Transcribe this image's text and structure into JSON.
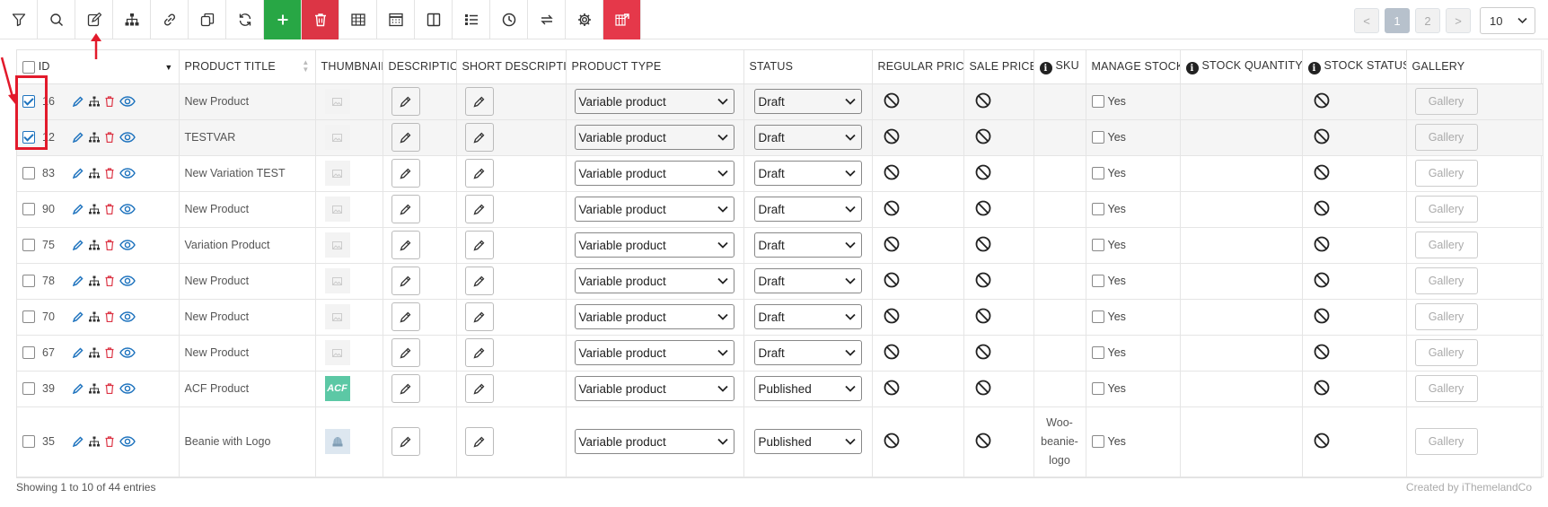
{
  "toolbar": {
    "icons": [
      "filter-icon",
      "search-icon",
      "bulk-edit-icon",
      "sitemap-icon",
      "link-icon",
      "duplicate-icon",
      "refresh-icon",
      "add-icon",
      "trash-icon",
      "table-icon",
      "calendar-grid-icon",
      "columns-icon",
      "list-icon",
      "clock-icon",
      "swap-icon",
      "gear-icon",
      "export-icon"
    ]
  },
  "pagination": {
    "prev": "<",
    "pages": [
      "1",
      "2"
    ],
    "current": "1",
    "next": ">",
    "per_page": "10"
  },
  "table": {
    "columns": {
      "id": "ID",
      "title": "PRODUCT TITLE",
      "thumbnail": "THUMBNAIL",
      "description": "DESCRIPTION",
      "short_description": "SHORT DESCRIPTION",
      "product_type": "PRODUCT TYPE",
      "status": "STATUS",
      "regular_price": "REGULAR PRICE",
      "sale_price": "SALE PRICE",
      "sku": "SKU",
      "manage_stock": "MANAGE STOCK",
      "stock_quantity": "STOCK QUANTITY",
      "stock_status": "STOCK STATUS",
      "gallery": "GALLERY"
    },
    "rows": [
      {
        "id": "16",
        "title": "New Product",
        "thumb": "placeholder",
        "type": "Variable product",
        "status": "Draft",
        "sku": "",
        "manage": "Yes",
        "gallery": "Gallery",
        "checked": true
      },
      {
        "id": "12",
        "title": "TESTVAR",
        "thumb": "placeholder",
        "type": "Variable product",
        "status": "Draft",
        "sku": "",
        "manage": "Yes",
        "gallery": "Gallery",
        "checked": true
      },
      {
        "id": "83",
        "title": "New Variation TEST",
        "thumb": "placeholder",
        "type": "Variable product",
        "status": "Draft",
        "sku": "",
        "manage": "Yes",
        "gallery": "Gallery",
        "checked": false
      },
      {
        "id": "90",
        "title": "New Product",
        "thumb": "placeholder",
        "type": "Variable product",
        "status": "Draft",
        "sku": "",
        "manage": "Yes",
        "gallery": "Gallery",
        "checked": false
      },
      {
        "id": "75",
        "title": "Variation Product",
        "thumb": "placeholder",
        "type": "Variable product",
        "status": "Draft",
        "sku": "",
        "manage": "Yes",
        "gallery": "Gallery",
        "checked": false
      },
      {
        "id": "78",
        "title": "New Product",
        "thumb": "placeholder",
        "type": "Variable product",
        "status": "Draft",
        "sku": "",
        "manage": "Yes",
        "gallery": "Gallery",
        "checked": false
      },
      {
        "id": "70",
        "title": "New Product",
        "thumb": "placeholder",
        "type": "Variable product",
        "status": "Draft",
        "sku": "",
        "manage": "Yes",
        "gallery": "Gallery",
        "checked": false
      },
      {
        "id": "67",
        "title": "New Product",
        "thumb": "placeholder",
        "type": "Variable product",
        "status": "Draft",
        "sku": "",
        "manage": "Yes",
        "gallery": "Gallery",
        "checked": false
      },
      {
        "id": "39",
        "title": "ACF Product",
        "thumb": "acf",
        "thumb_text": "ACF",
        "type": "Variable product",
        "status": "Published",
        "sku": "",
        "manage": "Yes",
        "gallery": "Gallery",
        "checked": false
      },
      {
        "id": "35",
        "title": "Beanie with Logo",
        "thumb": "beanie",
        "type": "Variable product",
        "status": "Published",
        "sku_lines": [
          "Woo-",
          "beanie-",
          "logo"
        ],
        "manage": "Yes",
        "gallery": "Gallery",
        "checked": false
      }
    ]
  },
  "footer": {
    "entries": "Showing 1 to 10 of 44 entries",
    "credit": "Created by iThemelandCo"
  },
  "colors": {
    "accent_blue": "#1e73be",
    "danger_red": "#dc3545",
    "success_green": "#28a745",
    "annotation_red": "#e21a2b"
  }
}
